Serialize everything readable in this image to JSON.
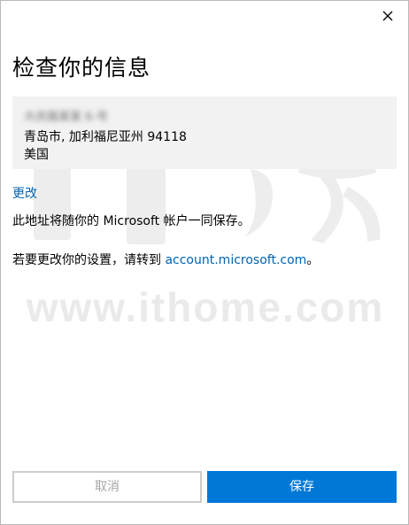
{
  "dialog": {
    "title": "检查你的信息",
    "close_icon": "close-icon"
  },
  "address": {
    "name": "大庆路某某 6-号",
    "line1": "青岛市, 加利福尼亚州 94118",
    "line2": "美国"
  },
  "change_link": "更改",
  "info_text": "此地址将随你的 Microsoft 帐户一同保存。",
  "settings": {
    "prefix": "若要更改你的设置，请转到 ",
    "link": "account.microsoft.com",
    "suffix": "。"
  },
  "buttons": {
    "cancel_label": "取消",
    "save_label": "保存"
  },
  "watermark": {
    "text": "www.ithome.com"
  },
  "colors": {
    "accent": "#0078d7",
    "link": "#0063b1",
    "card_bg": "#f2f2f2",
    "disabled_text": "#a6a6a6"
  }
}
